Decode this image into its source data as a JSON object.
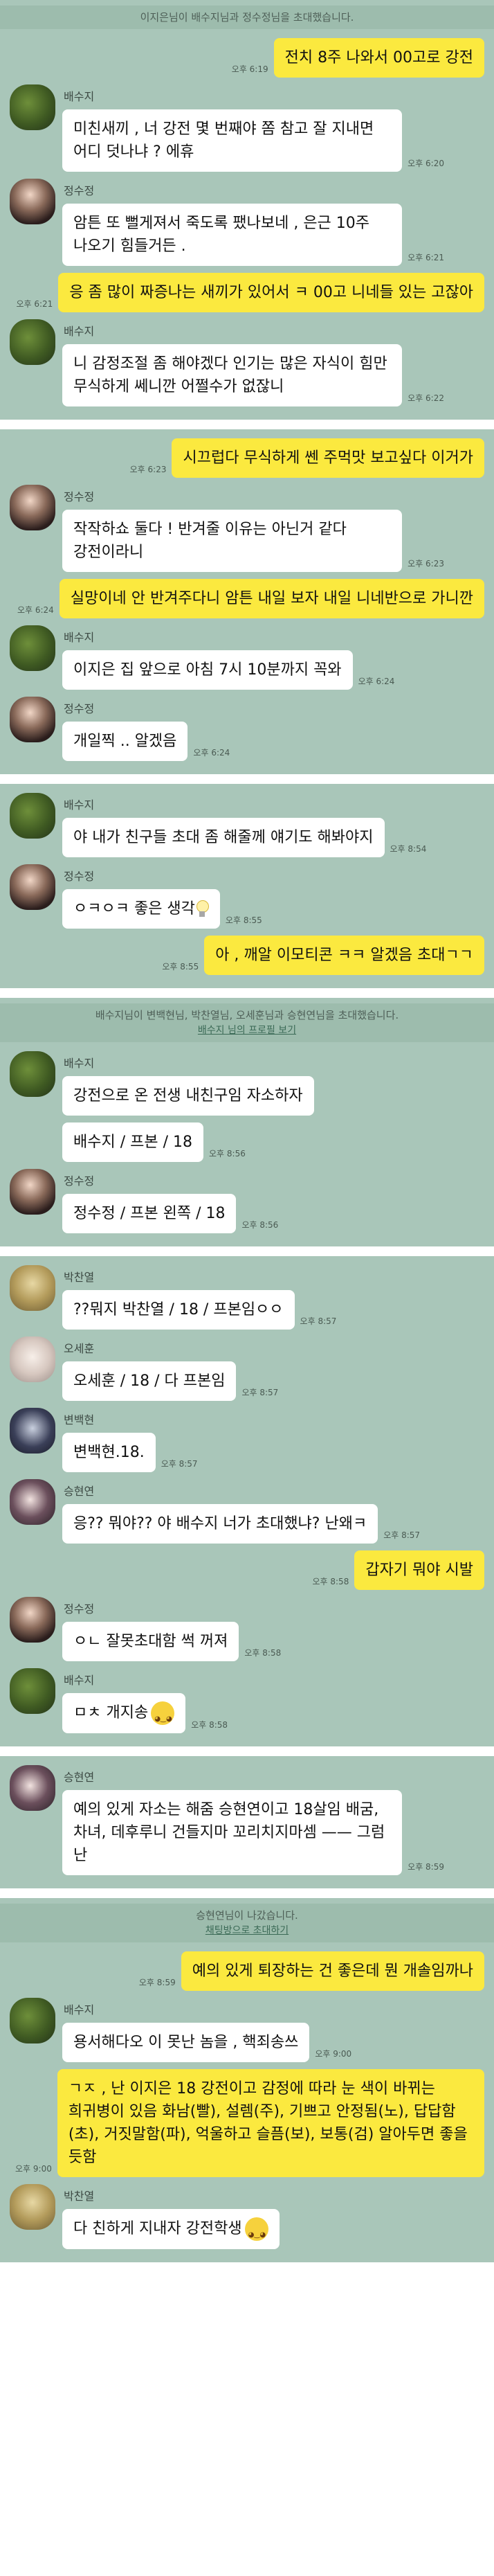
{
  "panels": [
    {
      "system": [
        "이지은님이 배수지님과 정수정님을 초대했습니다."
      ],
      "messages": [
        {
          "side": "me",
          "text": "전치 8주 나와서 00고로 강전",
          "time": "오후 6:19"
        },
        {
          "side": "other",
          "name": "배수지",
          "avatar": "baesuzy",
          "text": "미친새끼 , 너 강전 몇 번째야 쫌 참고 잘 지내면 어디 덧나냐 ? 에휴",
          "time": "오후 6:20"
        },
        {
          "side": "other",
          "name": "정수정",
          "avatar": "jeong",
          "text": "암튼 또 뻘게져서 죽도록 팼나보네 , 은근 10주 나오기 힘들거든 .",
          "time": "오후 6:21"
        },
        {
          "side": "me",
          "text": "응 좀 많이 짜증나는 새끼가 있어서 ㅋ 00고 니네들 있는 고잖아",
          "time": "오후 6:21"
        },
        {
          "side": "other",
          "name": "배수지",
          "avatar": "baesuzy",
          "text": "니 감정조절 좀 해야겠다 인기는 많은 자식이 힘만 무식하게 쎄니깐 어쩔수가 없잖니",
          "time": "오후 6:22"
        }
      ]
    },
    {
      "system": [],
      "messages": [
        {
          "side": "me",
          "text": "시끄럽다 무식하게 쎈 주먹맛 보고싶다 이거가",
          "time": "오후 6:23"
        },
        {
          "side": "other",
          "name": "정수정",
          "avatar": "jeong",
          "text": "작작하쇼 둘다 ! 반겨줄 이유는 아닌거 같다 강전이라니",
          "time": "오후 6:23"
        },
        {
          "side": "me",
          "text": "실망이네 안 반겨주다니 암튼 내일 보자 내일 니네반으로 가니깐",
          "time": "오후 6:24"
        },
        {
          "side": "other",
          "name": "배수지",
          "avatar": "baesuzy",
          "text": "이지은 집 앞으로 아침 7시 10분까지 꼭와",
          "time": "오후 6:24"
        },
        {
          "side": "other",
          "name": "정수정",
          "avatar": "jeong",
          "text": "개일찍 .. 알겠음",
          "time": "오후 6:24"
        }
      ]
    },
    {
      "system": [],
      "messages": [
        {
          "side": "other",
          "name": "배수지",
          "avatar": "baesuzy",
          "text": "야 내가 친구들 초대 좀 해줄께 얘기도 해봐야지",
          "time": "오후 8:54"
        },
        {
          "side": "other",
          "name": "정수정",
          "avatar": "jeong",
          "text": "ㅇㅋㅇㅋ 좋은 생각",
          "emoji": "bulb",
          "time": "오후 8:55"
        },
        {
          "side": "me",
          "text": "아 , 깨알 이모티콘 ㅋㅋ 알겠음 초대ㄱㄱ",
          "time": "오후 8:55"
        }
      ]
    },
    {
      "system": [
        "배수지님이 변백현님, 박찬열님, 오세훈님과 승현연님을 초대했습니다."
      ],
      "system_link": "배수지 님의 프로필 보기",
      "messages": [
        {
          "side": "other",
          "name": "배수지",
          "avatar": "baesuzy",
          "text": "강전으로 온 전생 내친구임 자소하자",
          "time": ""
        },
        {
          "side": "other",
          "name": "",
          "avatar": "",
          "text": "배수지 / 프본 / 18",
          "time": "오후 8:56"
        },
        {
          "side": "other",
          "name": "정수정",
          "avatar": "jeong",
          "text": "정수정 / 프본 왼쪽 / 18",
          "time": "오후 8:56"
        }
      ]
    },
    {
      "system": [],
      "messages": [
        {
          "side": "other",
          "name": "박찬열",
          "avatar": "chan",
          "text": "??뭐지 박찬열 / 18 / 프본임ㅇㅇ",
          "time": "오후 8:57"
        },
        {
          "side": "other",
          "name": "오세훈",
          "avatar": "sehun",
          "text": "오세훈 / 18 / 다 프본임",
          "time": "오후 8:57"
        },
        {
          "side": "other",
          "name": "변백현",
          "avatar": "baekhyun",
          "text": "변백현.18.",
          "time": "오후 8:57"
        },
        {
          "side": "other",
          "name": "승현연",
          "avatar": "seunghyun",
          "text": "응?? 뭐야?? 야 배수지 너가 초대했냐? 난왜ㅋ",
          "time": "오후 8:57"
        },
        {
          "side": "me",
          "text": "갑자기 뭐야 시발",
          "time": "오후 8:58"
        },
        {
          "side": "other",
          "name": "정수정",
          "avatar": "jeong",
          "text": "ㅇㄴ 잘못초대함 썩 꺼져",
          "time": "오후 8:58"
        },
        {
          "side": "other",
          "name": "배수지",
          "avatar": "baesuzy",
          "text": "ㅁㅊ 개지송",
          "emoji": "smile",
          "time": "오후 8:58"
        }
      ]
    },
    {
      "system": [],
      "messages": [
        {
          "side": "other",
          "name": "승현연",
          "avatar": "seunghyun",
          "text": "예의 있게 자소는 해줌 승현연이고 18살임 배굼, 차녀, 데후루니 건들지마 꼬리치지마셈 —— 그럼 난",
          "time": "오후 8:59"
        }
      ]
    },
    {
      "system": [
        "승현연님이 나갔습니다."
      ],
      "system_link": "채팅방으로 초대하기",
      "messages": [
        {
          "side": "me",
          "text": "예의 있게 퇴장하는 건 좋은데 뭔 개솔임까나",
          "time": "오후 8:59"
        },
        {
          "side": "other",
          "name": "배수지",
          "avatar": "baesuzy",
          "text": "용서해다오 이 못난 놈을 , 핵죄송쓰",
          "time": "오후 9:00"
        },
        {
          "side": "me",
          "text": "ㄱㅈ , 난 이지은 18 강전이고 감정에 따라 눈 색이 바뀌는 희귀병이 있음 화남(빨), 설렘(주), 기쁘고 안정됨(노), 답답함(초), 거짓말함(파), 억울하고 슬픔(보), 보통(검) 알아두면 좋을 듯함",
          "time": "오후 9:00"
        },
        {
          "side": "other",
          "name": "박찬열",
          "avatar": "chan",
          "text": "다 친하게 지내자 강전학생",
          "emoji": "smile",
          "time": ""
        }
      ]
    }
  ]
}
